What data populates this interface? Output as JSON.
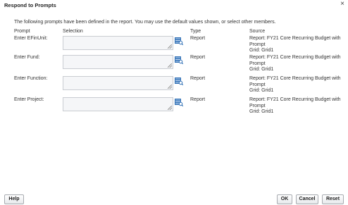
{
  "dialog": {
    "title": "Respond to Prompts",
    "close_glyph": "×"
  },
  "intro": "The following prompts have been defined in the report. You may use the default values shown, or select other members.",
  "columns": {
    "prompt": "Prompt",
    "selection": "Selection",
    "type": "Type",
    "source": "Source"
  },
  "rows": [
    {
      "label": "Enter EFinUnit:",
      "value": "",
      "type": "Report",
      "source_line1": "Report: FY21 Core Recurring Budget with",
      "source_line2": "Prompt",
      "source_line3": "Grid: Grid1"
    },
    {
      "label": "Enter Fund:",
      "value": "",
      "type": "Report",
      "source_line1": "Report: FY21 Core Recurring Budget with",
      "source_line2": "Prompt",
      "source_line3": "Grid: Grid1"
    },
    {
      "label": "Enter Function:",
      "value": "",
      "type": "Report",
      "source_line1": "Report: FY21 Core Recurring Budget with",
      "source_line2": "Prompt",
      "source_line3": "Grid: Grid1"
    },
    {
      "label": "Enter Project:",
      "value": "",
      "type": "Report",
      "source_line1": "Report: FY21 Core Recurring Budget with",
      "source_line2": "Prompt",
      "source_line3": "Grid: Grid1"
    }
  ],
  "buttons": {
    "help": "Help",
    "ok": "OK",
    "cancel": "Cancel",
    "reset": "Reset"
  },
  "icons": {
    "picker": "member-selector-icon",
    "close": "close-icon"
  },
  "colors": {
    "picker_blue": "#2f6fb5",
    "field_bg": "#f5f6f8",
    "field_border": "#c9ccd1"
  }
}
